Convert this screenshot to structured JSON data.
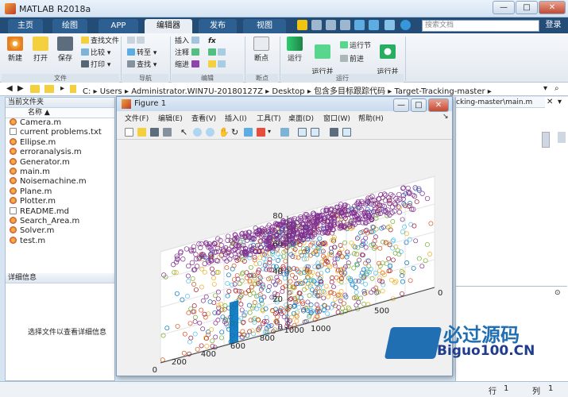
{
  "window": {
    "title": "MATLAB R2018a",
    "min": "—",
    "max": "□",
    "close": "✕"
  },
  "tabs": [
    {
      "label": "主页"
    },
    {
      "label": "绘图"
    },
    {
      "label": "APP"
    },
    {
      "label": "编辑器"
    },
    {
      "label": "发布"
    },
    {
      "label": "视图"
    }
  ],
  "search": {
    "placeholder": "搜索文档"
  },
  "login": "登录",
  "ribbon": {
    "file": {
      "new": "新建",
      "open": "打开",
      "save": "保存",
      "find_files": "查找文件",
      "compare": "比较",
      "print": "打印",
      "group": "文件"
    },
    "nav": {
      "goto": "转至",
      "find": "查找",
      "group": "导航"
    },
    "edit": {
      "insert": "插入",
      "comment": "注释",
      "indent": "缩进",
      "fx": "fx",
      "group": "编辑"
    },
    "breakpoints": {
      "label": "断点",
      "group": "断点"
    },
    "run": {
      "run": "运行",
      "run_advance": "运行并\n前进",
      "run_section": "运行节",
      "advance": "前进",
      "run_time": "运行并\n计时",
      "group": "运行"
    }
  },
  "address": {
    "drive": "C:",
    "sep": "▸",
    "parts": [
      "Users",
      "Administrator.WIN7U-20180127Z",
      "Desktop",
      "包含多目标跟踪代码",
      "Target-Tracking-master"
    ]
  },
  "current_folder": {
    "header": "当前文件夹",
    "column": "名称 ▲",
    "files": [
      {
        "name": "Camera.m",
        "type": "m"
      },
      {
        "name": "current problems.txt",
        "type": "txt"
      },
      {
        "name": "Ellipse.m",
        "type": "m"
      },
      {
        "name": "erroranalysis.m",
        "type": "m"
      },
      {
        "name": "Generator.m",
        "type": "m"
      },
      {
        "name": "main.m",
        "type": "m"
      },
      {
        "name": "Noisemachine.m",
        "type": "m"
      },
      {
        "name": "Plane.m",
        "type": "m"
      },
      {
        "name": "Plotter.m",
        "type": "m"
      },
      {
        "name": "README.md",
        "type": "txt"
      },
      {
        "name": "Search_Area.m",
        "type": "m"
      },
      {
        "name": "Solver.m",
        "type": "m"
      },
      {
        "name": "test.m",
        "type": "m"
      }
    ]
  },
  "details": {
    "header": "详细信息",
    "text": "选择文件以查看详细信息"
  },
  "editor_tab": "cking-master\\main.m",
  "figure": {
    "title": "Figure 1",
    "menu": [
      "文件(F)",
      "编辑(E)",
      "查看(V)",
      "插入(I)",
      "工具(T)",
      "桌面(D)",
      "窗口(W)",
      "帮助(H)"
    ]
  },
  "chart_data": {
    "type": "scatter",
    "zlim": [
      0,
      80
    ],
    "zticks": [
      0,
      20,
      40,
      60,
      80
    ],
    "xlim": [
      0,
      1000
    ],
    "xticks": [
      0,
      500,
      1000
    ],
    "ylim": [
      0,
      1000
    ],
    "yticks": [
      0,
      200,
      400,
      600,
      800,
      1000
    ],
    "grid": true
  },
  "status": {
    "row_label": "行",
    "row": "1",
    "col_label": "列",
    "col": "1"
  },
  "watermark": {
    "line1": "必过源码",
    "line2": "Biguo100.CN"
  }
}
